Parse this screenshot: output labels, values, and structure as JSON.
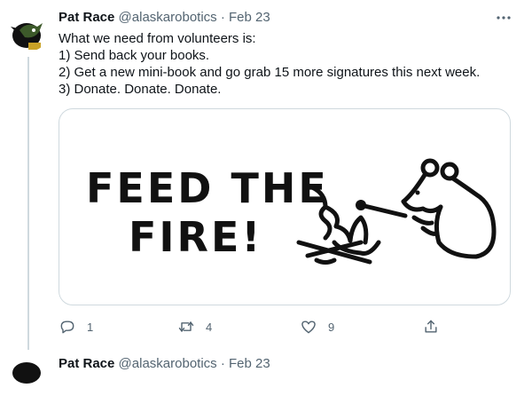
{
  "tweet": {
    "name": "Pat Race",
    "handle": "@alaskarobotics",
    "separator": "·",
    "date": "Feb 23",
    "lines": [
      "What we need from volunteers is:",
      "1) Send back your books.",
      "2) Get a new mini-book and go grab 15 more signatures this next week.",
      "3) Donate. Donate. Donate."
    ],
    "image_text": {
      "line1": "FEED THE",
      "line2": "FIRE!"
    },
    "actions": {
      "reply_count": "1",
      "retweet_count": "4",
      "like_count": "9"
    }
  },
  "next_tweet": {
    "name": "Pat Race",
    "handle": "@alaskarobotics",
    "separator": "·",
    "date": "Feb 23"
  },
  "icons": {
    "more": "more-dots-icon",
    "reply": "reply-icon",
    "retweet": "retweet-icon",
    "like": "heart-icon",
    "share": "share-icon"
  },
  "colors": {
    "muted": "#536471",
    "border": "#cfd9de",
    "text": "#0f1419",
    "avatar_green": "#3d5a2a"
  }
}
